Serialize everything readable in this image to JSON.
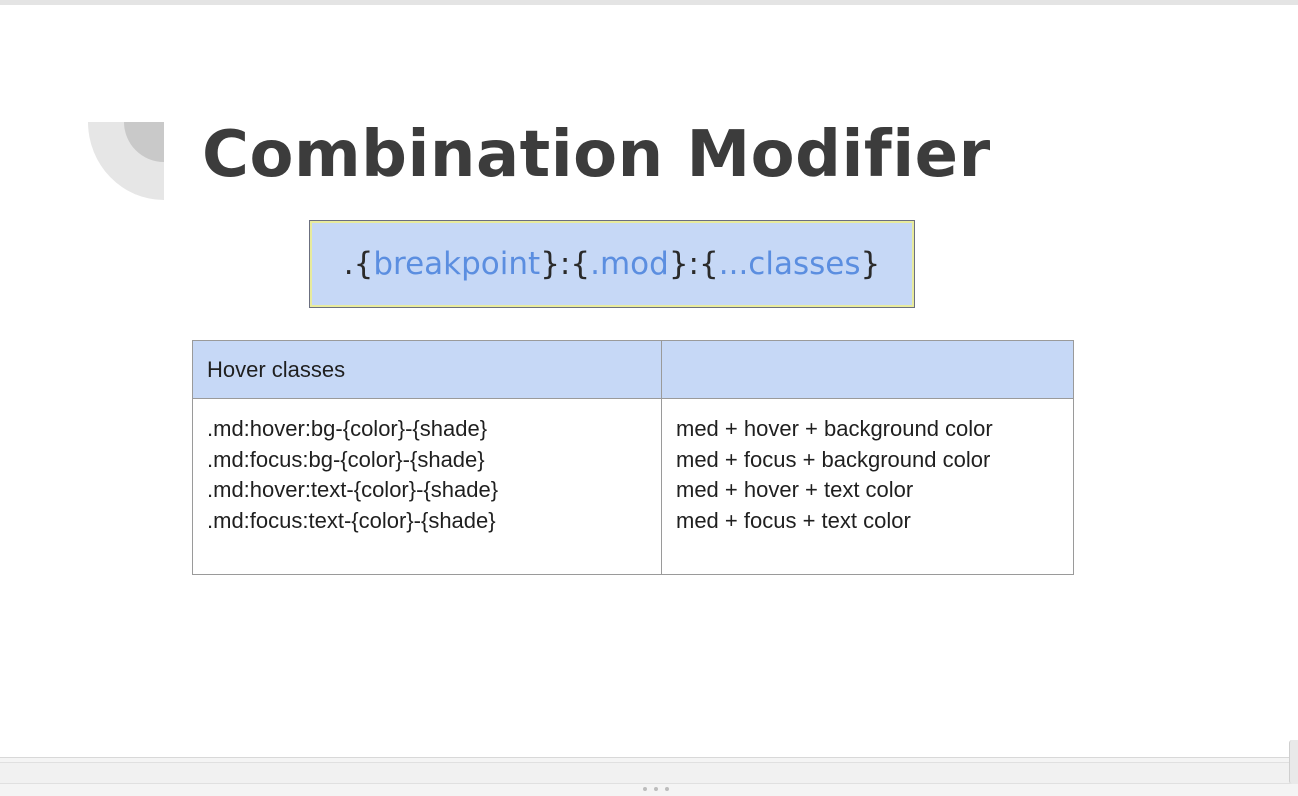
{
  "slide": {
    "title": "Combination Modifier",
    "syntax": {
      "dot": ".",
      "open1": "{",
      "breakpoint": "breakpoint",
      "close1": "}",
      "colon1": ":",
      "open2": "{",
      "mod": ".mod",
      "close2": "}",
      "colon2": ":",
      "open3": "{",
      "classes": "...classes",
      "close3": "}"
    },
    "table": {
      "headers": [
        "Hover classes",
        ""
      ],
      "left_lines": [
        ".md:hover:bg-{color}-{shade}",
        ".md:focus:bg-{color}-{shade}",
        ".md:hover:text-{color}-{shade}",
        ".md:focus:text-{color}-{shade}"
      ],
      "right_lines": [
        "med + hover + background color",
        "med + focus + background color",
        "med + hover + text color",
        "med + focus + text color"
      ]
    }
  },
  "colors": {
    "accent_blue": "#5b8ee0",
    "header_fill": "#c6d8f6",
    "title_text": "#3c3c3c"
  }
}
